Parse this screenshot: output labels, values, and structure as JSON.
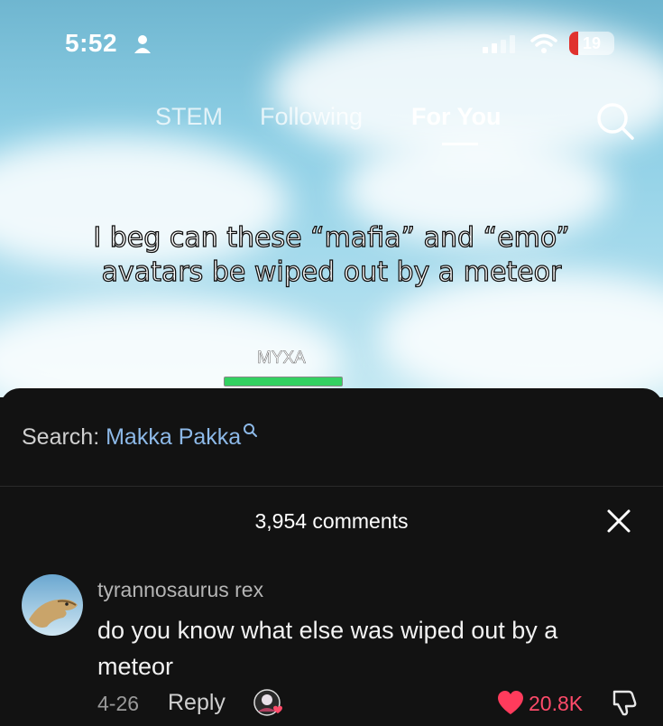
{
  "status_bar": {
    "time": "5:52",
    "battery": "19",
    "battery_level": 0.19
  },
  "tabs": [
    {
      "label": "STEM",
      "active": false
    },
    {
      "label": "Following",
      "active": false
    },
    {
      "label": "For You",
      "active": true
    }
  ],
  "video": {
    "caption_line1": "I beg can these “mafia” and “emo”",
    "caption_line2": "avatars be wiped out by a meteor",
    "watermark": "MYXA"
  },
  "search": {
    "label": "Search: ",
    "term": "Makka Pakka"
  },
  "comments": {
    "count_label": "3,954 comments",
    "items": [
      {
        "username": "tyrannosaurus rex",
        "text": "do you know what else was wiped out by a meteor",
        "date": "4-26",
        "reply_label": "Reply",
        "likes": "20.8K"
      }
    ]
  },
  "colors": {
    "accent_red": "#ff4b6a",
    "search_blue": "#8db9e8",
    "battery_red": "#e0322e"
  }
}
